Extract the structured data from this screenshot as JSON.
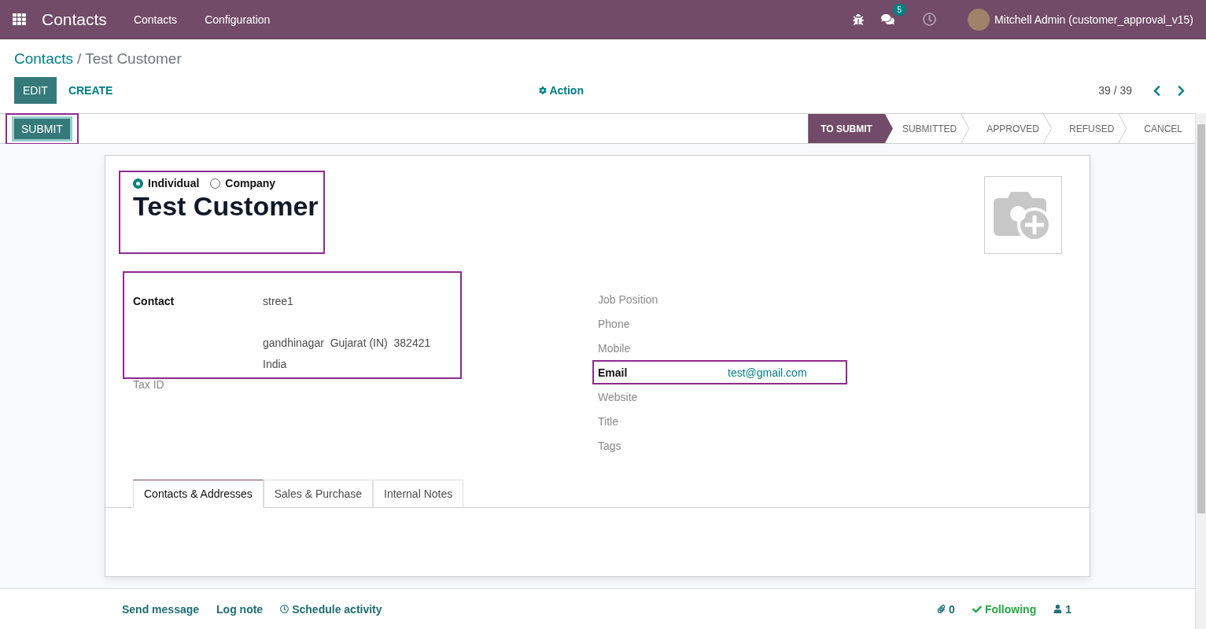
{
  "navbar": {
    "app_title": "Contacts",
    "menus": [
      "Contacts",
      "Configuration"
    ],
    "message_count": "5",
    "user": "Mitchell Admin (customer_approval_v15)"
  },
  "breadcrumb_separator": "/",
  "breadcrumb": [
    {
      "label": "Contacts",
      "kind": "link"
    },
    {
      "label": "Test Customer",
      "kind": "current"
    }
  ],
  "buttons": {
    "edit": "EDIT",
    "create": "CREATE",
    "action": "Action",
    "pager": "39 / 39"
  },
  "header": {
    "submit": "SUBMIT",
    "stages": [
      {
        "label": "TO SUBMIT",
        "selected": true
      },
      {
        "label": "SUBMITTED",
        "selected": false
      },
      {
        "label": "APPROVED",
        "selected": false
      },
      {
        "label": "REFUSED",
        "selected": false
      },
      {
        "label": "CANCEL",
        "selected": false
      }
    ]
  },
  "form": {
    "company_type": [
      {
        "label": "Individual",
        "selected": true
      },
      {
        "label": "Company",
        "selected": false
      }
    ],
    "name": "Test Customer",
    "contact": {
      "label": "Contact",
      "lines": [
        "stree1",
        "gandhinagar  Gujarat (IN)  382421",
        "India"
      ]
    },
    "tax_id": "Tax ID",
    "right_fields": [
      {
        "label": "Job Position"
      },
      {
        "label": "Phone"
      },
      {
        "label": "Mobile"
      },
      {
        "label": "Email",
        "value": "test@gmail.com"
      },
      {
        "label": "Website"
      },
      {
        "label": "Title"
      },
      {
        "label": "Tags"
      }
    ],
    "tabs": [
      {
        "label": "Contacts & Addresses",
        "selected": true
      },
      {
        "label": "Sales & Purchase",
        "selected": false
      },
      {
        "label": "Internal Notes",
        "selected": false
      }
    ]
  },
  "chatter": {
    "send_message": "Send message",
    "log_note": "Log note",
    "schedule_activity": "Schedule activity",
    "attachments": "0",
    "following": "Following",
    "followers": "1"
  }
}
